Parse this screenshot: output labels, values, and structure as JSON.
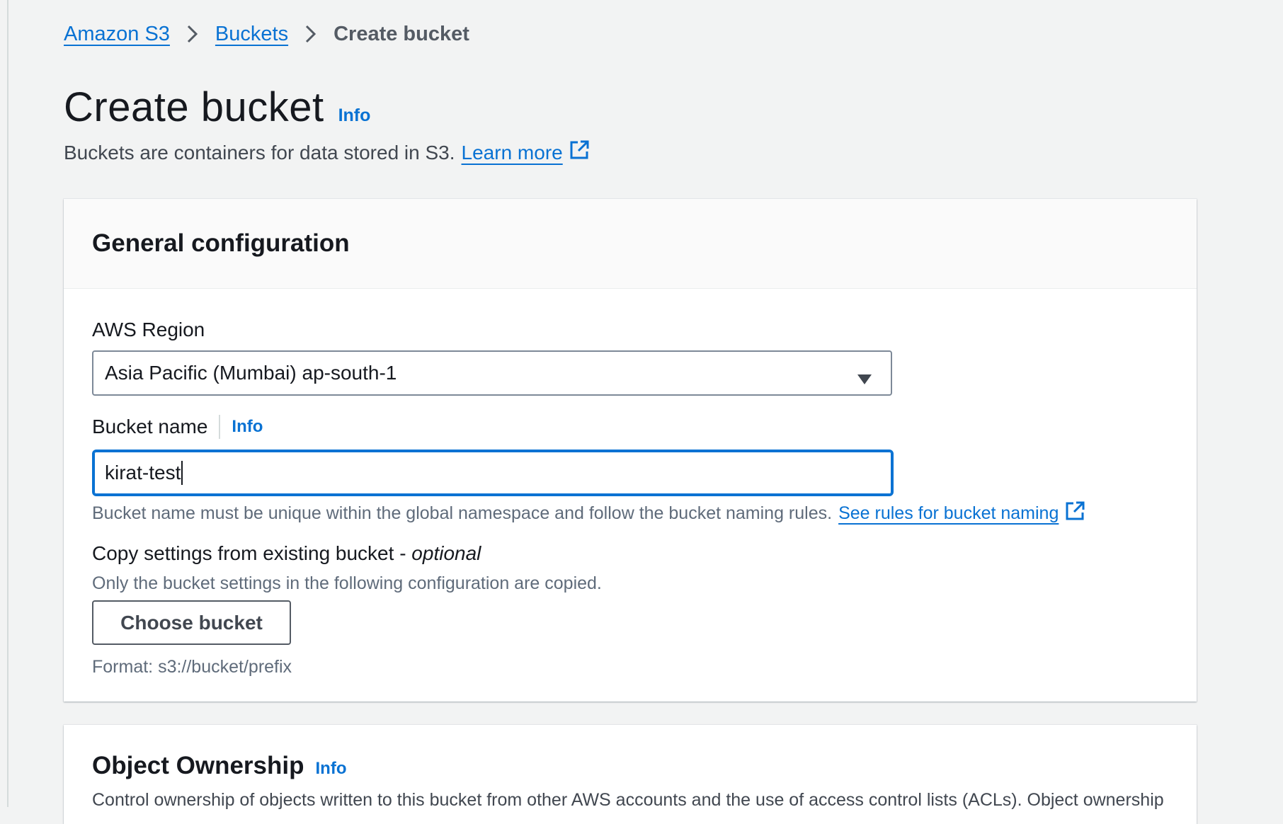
{
  "breadcrumb": {
    "items": [
      "Amazon S3",
      "Buckets"
    ],
    "current": "Create bucket"
  },
  "page": {
    "title": "Create bucket",
    "info": "Info",
    "description": "Buckets are containers for data stored in S3.",
    "learn_more": "Learn more"
  },
  "general": {
    "title": "General configuration",
    "region_label": "AWS Region",
    "region_value": "Asia Pacific (Mumbai) ap-south-1",
    "bucket_name_label": "Bucket name",
    "bucket_name_info": "Info",
    "bucket_name_value": "kirat-test",
    "bucket_name_hint": "Bucket name must be unique within the global namespace and follow the bucket naming rules.",
    "naming_rules_link": "See rules for bucket naming",
    "copy_label": "Copy settings from existing bucket -",
    "copy_label_optional": "optional",
    "copy_hint": "Only the bucket settings in the following configuration are copied.",
    "choose_bucket": "Choose bucket",
    "format_hint": "Format: s3://bucket/prefix"
  },
  "ownership": {
    "title": "Object Ownership",
    "info": "Info",
    "description": "Control ownership of objects written to this bucket from other AWS accounts and the use of access control lists (ACLs). Object ownership"
  },
  "colors": {
    "link": "#0972d3",
    "background": "#f2f3f3",
    "panel": "#ffffff",
    "focus_border": "#0972d3"
  }
}
